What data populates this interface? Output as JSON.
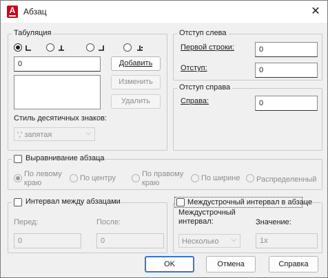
{
  "window": {
    "title": "Абзац",
    "app_icon_letter": "A",
    "close_glyph": "✕"
  },
  "tabs_group": {
    "title": "Табуляция",
    "tab_value": "0",
    "add_label": "Добавить",
    "change_label": "Изменить",
    "delete_label": "Удалить",
    "decimal_style_label": "Стиль десятичных знаков:",
    "decimal_style_value": "',' запятая"
  },
  "left_indent": {
    "title": "Отступ слева",
    "first_line_label": "Первой строки:",
    "first_line_value": "0",
    "indent_label": "Отступ:",
    "indent_value": "0"
  },
  "right_indent": {
    "title": "Отступ справа",
    "right_label": "Справа:",
    "right_value": "0"
  },
  "alignment": {
    "title": "Выравнивание абзаца",
    "options": [
      {
        "label_line1": "По левому",
        "label_line2": "краю"
      },
      {
        "label_line1": "По центру",
        "label_line2": ""
      },
      {
        "label_line1": "По правому",
        "label_line2": "краю"
      },
      {
        "label_line1": "По ширине",
        "label_line2": ""
      },
      {
        "label_line1": "Распределенный",
        "label_line2": ""
      }
    ]
  },
  "spacing": {
    "title": "Интервал между абзацами",
    "before_label": "Перед:",
    "before_value": "0",
    "after_label": "После:",
    "after_value": "0"
  },
  "line_spacing": {
    "title": "Междустрочный интервал в абзаце",
    "interval_label_1": "Междустрочный",
    "interval_label_2": "интервал:",
    "interval_value": "Несколько",
    "value_label": "Значение:",
    "value_value": "1x"
  },
  "footer": {
    "ok": "OK",
    "cancel": "Отмена",
    "help": "Справка"
  }
}
